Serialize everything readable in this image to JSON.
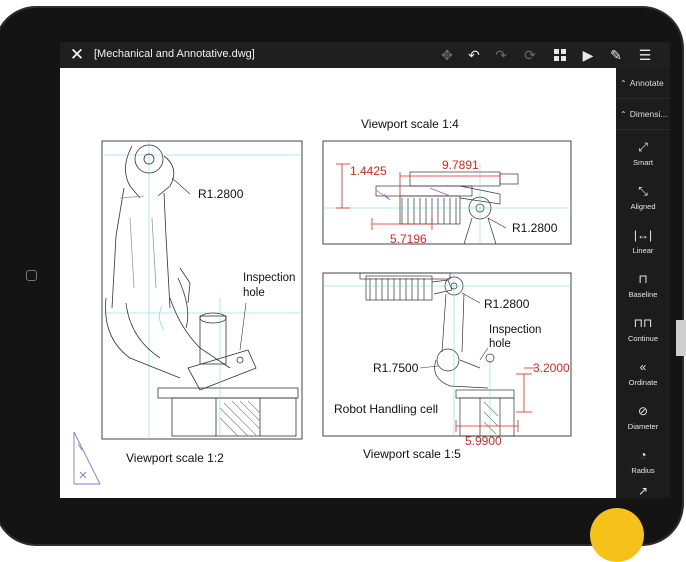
{
  "app": {
    "title": "[Mechanical and Annotative.dwg]"
  },
  "toolbar": {
    "icons": [
      "close-icon",
      "move-icon",
      "undo-icon",
      "redo-icon",
      "sync-icon",
      "grid-icon",
      "play-icon",
      "pen-icon",
      "menu-icon"
    ]
  },
  "right_panel": {
    "top_items": [
      {
        "label": "Annotate"
      },
      {
        "label": "Dimensi..."
      }
    ],
    "tools": [
      {
        "label": "Smart"
      },
      {
        "label": "Aligned"
      },
      {
        "label": "Linear"
      },
      {
        "label": "Baseline"
      },
      {
        "label": "Continue"
      },
      {
        "label": "Ordinate"
      },
      {
        "label": "Diameter"
      },
      {
        "label": "Radius"
      }
    ]
  },
  "drawing": {
    "viewport_titles": {
      "top_right": "Viewport scale 1:4",
      "left": "Viewport scale 1:2",
      "bottom_right": "Viewport scale 1:5"
    },
    "annotations": {
      "r_left": "R1.2800",
      "inspection_left": "Inspection",
      "hole_left": "hole",
      "dim_14425": "1.4425",
      "dim_97891": "9.7891",
      "dim_57196": "5.7196",
      "r_top": "R1.2800",
      "r_bottom": "R1.2800",
      "inspection_bottom": "Inspection",
      "hole_bottom": "hole",
      "r175": "R1.7500",
      "dim_32000": "3.2000",
      "dim_59900": "5.9900",
      "robot_cell": "Robot Handling cell"
    }
  },
  "colors": {
    "dimension_red": "#e0241f",
    "panel_bg": "#1c1c1c",
    "topbar_bg": "#1f1f1f"
  }
}
